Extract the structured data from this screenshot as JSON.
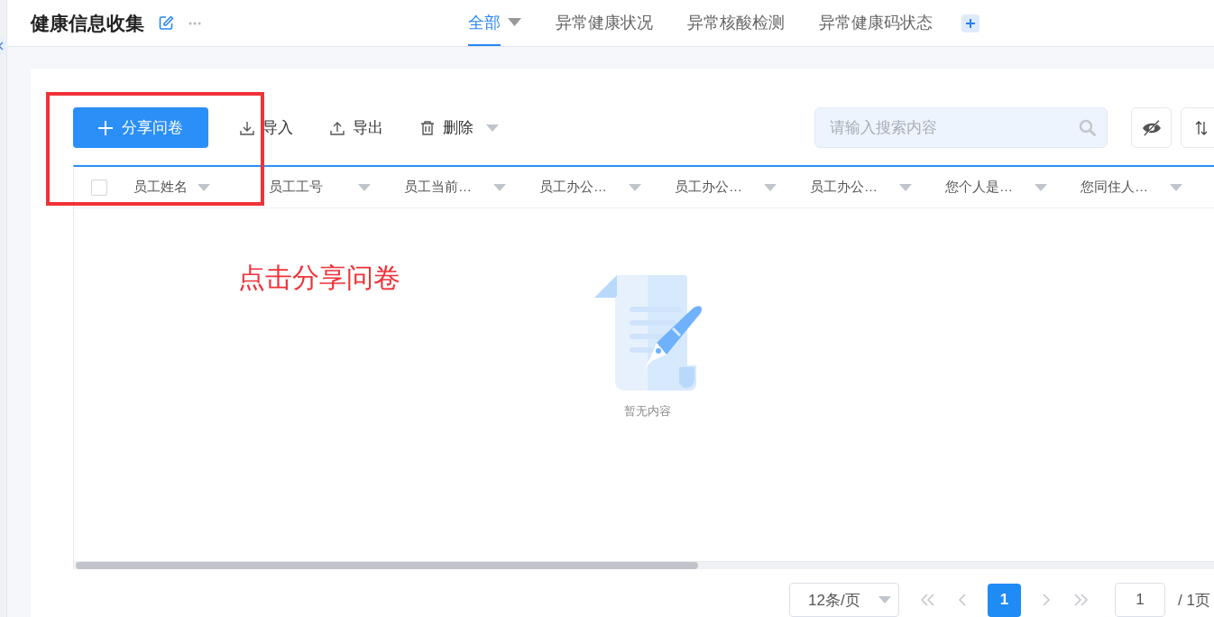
{
  "header": {
    "title": "健康信息收集",
    "tabs": [
      {
        "label": "全部",
        "selected": true,
        "dropdown": true
      },
      {
        "label": "异常健康状况",
        "selected": false,
        "dropdown": false
      },
      {
        "label": "异常核酸检测",
        "selected": false,
        "dropdown": false
      },
      {
        "label": "异常健康码状态",
        "selected": false,
        "dropdown": false
      }
    ]
  },
  "toolbar": {
    "primary": "分享问卷",
    "actions": [
      {
        "kind": "import",
        "label": "导入",
        "dropdown": false
      },
      {
        "kind": "export",
        "label": "导出",
        "dropdown": false
      },
      {
        "kind": "delete",
        "label": "删除",
        "dropdown": true
      }
    ],
    "search": {
      "placeholder": "请输入搜索内容"
    }
  },
  "table": {
    "select_all": {
      "checked": false
    },
    "columns": [
      "员工姓名",
      "员工工号",
      "员工当前…",
      "员工办公…",
      "员工办公…",
      "员工办公…",
      "您个人是…",
      "您同住人…"
    ],
    "empty_text": "暂无内容"
  },
  "pagination": {
    "page_size": "12条/页",
    "pages": [
      {
        "label": "1",
        "selected": true
      }
    ],
    "jump": "1",
    "total": "/ 1页"
  },
  "annotation": {
    "text": "点击分享问卷"
  }
}
